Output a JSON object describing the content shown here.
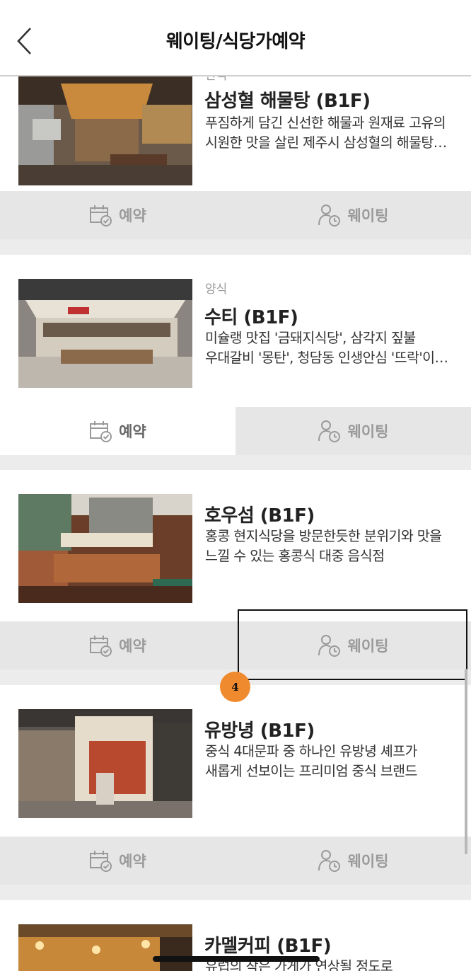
{
  "header": {
    "title": "웨이팅/식당가예약",
    "back_icon": "chevron-left-icon"
  },
  "restaurants": [
    {
      "category": "한식",
      "name": "삼성혈 해물탕 (B1F)",
      "desc_line1": "푸짐하게 담긴 신선한 해물과 원재료 고유의",
      "desc_line2": "시원한 맛을 살린 제주시 삼성혈의 해물탕…",
      "reserve_label": "예약",
      "waiting_label": "웨이팅"
    },
    {
      "category": "양식",
      "name": "수티 (B1F)",
      "desc_line1": "미슐랭 맛집 '금돼지식당', 삼각지 짚불",
      "desc_line2": "우대갈비 '몽탄', 청담동 인생안심 '뜨락'이…",
      "reserve_label": "예약",
      "waiting_label": "웨이팅"
    },
    {
      "category": "",
      "name": "호우섬 (B1F)",
      "desc_line1": "홍콩 현지식당을 방문한듯한 분위기와 맛을",
      "desc_line2": "느낄 수 있는 홍콩식 대중 음식점",
      "reserve_label": "예약",
      "waiting_label": "웨이팅"
    },
    {
      "category": "",
      "name": "유방녕 (B1F)",
      "desc_line1": "중식 4대문파 중 하나인 유방녕 셰프가",
      "desc_line2": "새롭게 선보이는 프리미엄 중식 브랜드",
      "reserve_label": "예약",
      "waiting_label": "웨이팅"
    },
    {
      "category": "",
      "name": "카멜커피 (B1F)",
      "desc_line1": "유럽의 작은 가게가 연상될 정도로",
      "desc_line2": ""
    }
  ],
  "overlay": {
    "step_badge": "4"
  },
  "colors": {
    "accent": "#f08a2e",
    "button_bg": "#e6e6e6",
    "button_text": "#9a9a9a"
  },
  "icons": {
    "reserve": "calendar-check-icon",
    "waiting": "person-clock-icon"
  }
}
